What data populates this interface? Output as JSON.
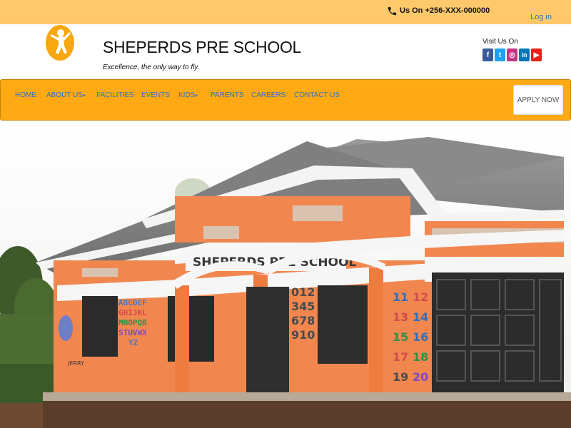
{
  "topbar": {
    "phone": "Us On +256-XXX-000000",
    "login": "Log in"
  },
  "brand": {
    "name": "SHEPERDS PRE SCHOOL",
    "tagline": "Excellence, the only way to fly.",
    "visit": "Visit Us On",
    "social_icons": [
      "facebook-icon",
      "twitter-icon",
      "instagram-icon",
      "linkedin-icon",
      "youtube-icon"
    ]
  },
  "nav": {
    "items": [
      {
        "label": "HOME"
      },
      {
        "label": "ABOUT US"
      },
      {
        "label": "FACILITIES"
      },
      {
        "label": "EVENTS"
      },
      {
        "label": "KIDS"
      },
      {
        "label": "PARENTS"
      },
      {
        "label": "CAREERS"
      },
      {
        "label": "CONTACT US"
      }
    ],
    "apply": "APPLY NOW"
  },
  "hero": {
    "sign": "SHEPERDS PRE SCHOOL",
    "wall_letters": [
      "ABCDEF",
      "GHIJKL",
      "MNOPQR",
      "STUVWX",
      "YZ"
    ],
    "wall_numbers": [
      "012",
      "345",
      "678",
      "910"
    ],
    "pillar_numbers": [
      "11",
      "12",
      "13",
      "14",
      "15",
      "16",
      "17",
      "18",
      "19",
      "20"
    ],
    "drawing_label": "JERRY"
  },
  "colors": {
    "topbar": "#ffc96b",
    "navbar": "#ffa915",
    "link": "#2c73c8",
    "wall": "#f1874f"
  }
}
